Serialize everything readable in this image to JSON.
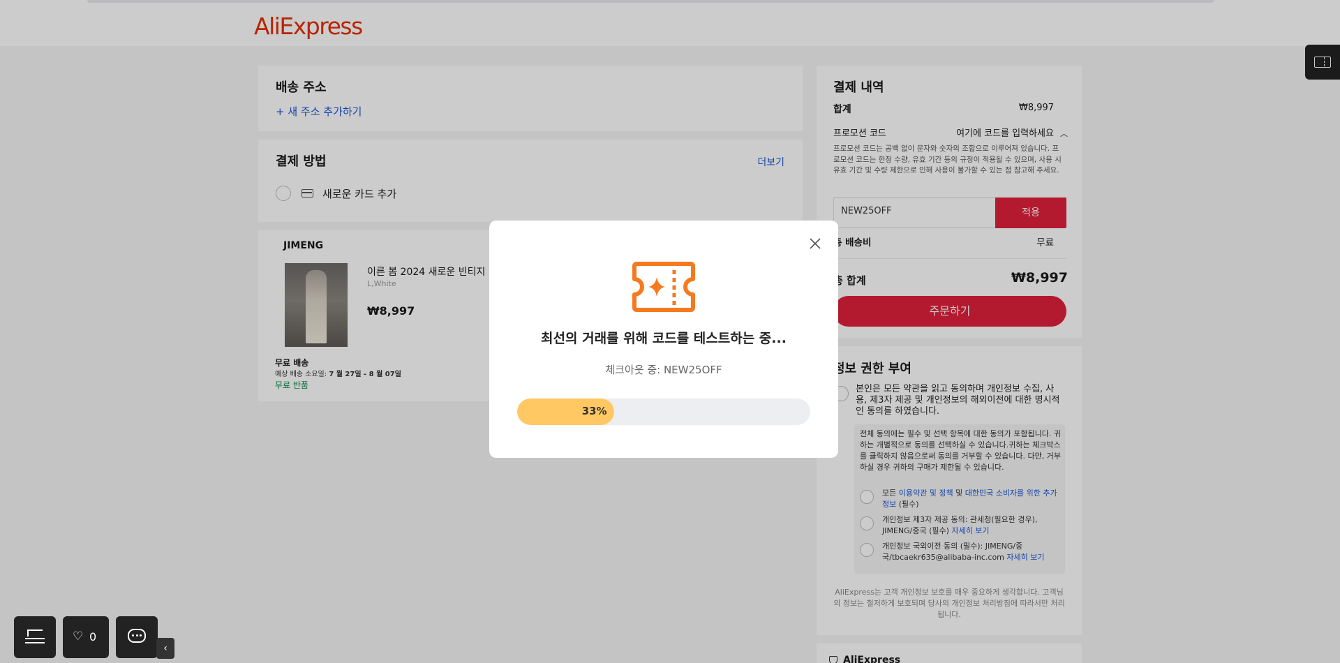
{
  "header": {
    "logo": "AliExpress"
  },
  "shipping": {
    "title": "배송 주소",
    "add_address": "+ 새 주소 추가하기"
  },
  "payment": {
    "title": "결제 방법",
    "more": "더보기",
    "new_card": "새로운 카드 추가"
  },
  "order": {
    "store": "JIMENG",
    "product_title": "이른 봄 2024 새로운 빈티지",
    "variant": "L,White",
    "price": "₩8,997",
    "free_shipping": "무료 배송",
    "delivery_prefix": "예상 배송 소요일: ",
    "delivery_dates": "7 월 27일 - 8 월 07일",
    "free_return": "무료 반품"
  },
  "summary": {
    "title": "결제 내역",
    "subtotal_label": "합계",
    "subtotal_value": "₩8,997",
    "promo_label": "프로모션 코드",
    "promo_toggle": "여기에 코드를 입력하세요",
    "promo_note": "프로모션 코드는 공백 없이 문자와 숫자의 조합으로 이루어져 있습니다. 프로모션 코드는 한정 수량, 유효 기간 등의 규정이 적용될 수 있으며, 사용 시 유효 기간 및 수량 제한으로 인해 사용이 불가할 수 있는 점 참고해 주세요.",
    "promo_input": "NEW25OFF",
    "apply": "적용",
    "shipping_label": "총 배송비",
    "shipping_value": "무료",
    "total_label": "총 합계",
    "total_value": "₩8,997",
    "order_button": "주문하기"
  },
  "consent": {
    "title": "정보 권한 부여",
    "main": "본인은 모든 약관을 읽고 동의하며 개인정보 수집, 사용, 제3자 제공 및 개인정보의 해외이전에 대한 명시적인 동의를 하였습니다.",
    "note": "전체 동의에는 필수 및 선택 항목에 대한 동의가 포함됩니다. 귀하는 개별적으로 동의를 선택하실 수 있습니다.귀하는 체크박스를 클릭하지 않음으로써 동의를 거부할 수 있습니다. 다만, 거부하실 경우 귀하의 구매가 제한될 수 있습니다.",
    "item1_pre": "모든 ",
    "item1_link1": "이용약관 및 정책",
    "item1_mid": " 및 ",
    "item1_link2": "대한민국 소비자를 위한 추가 정보",
    "item1_post": " (필수)",
    "item2_text": "개인정보 제3자 제공 동의: 관세청(필요한 경우), JIMENG/중국 (필수) ",
    "item2_link": "자세히 보기",
    "item3_text": "개인정보 국외이전 동의 (필수): JIMENG/중국/tbcaekr635@alibaba-inc.com ",
    "item3_link": "자세히 보기",
    "footer": "AliExpress는 고객 개인정보 보호를 매우 중요하게 생각합니다. 고객님의 정보는 철저하게 보호되며 당사의 개인정보 처리방침에 따라서만 처리됩니다.",
    "bottom_label": "AliExpress"
  },
  "modal": {
    "title": "최선의 거래를 위해 코드를 테스트하는 중...",
    "subtitle": "체크아웃 중: NEW25OFF",
    "progress_label": "33%",
    "progress_value": 0.33
  },
  "floating": {
    "wishlist_count": "0"
  },
  "colors": {
    "brand": "#e62e04",
    "accent_red": "#e0203b",
    "link": "#1a56d6",
    "progress": "#ffc863",
    "icon_orange": "#f57a1f"
  }
}
